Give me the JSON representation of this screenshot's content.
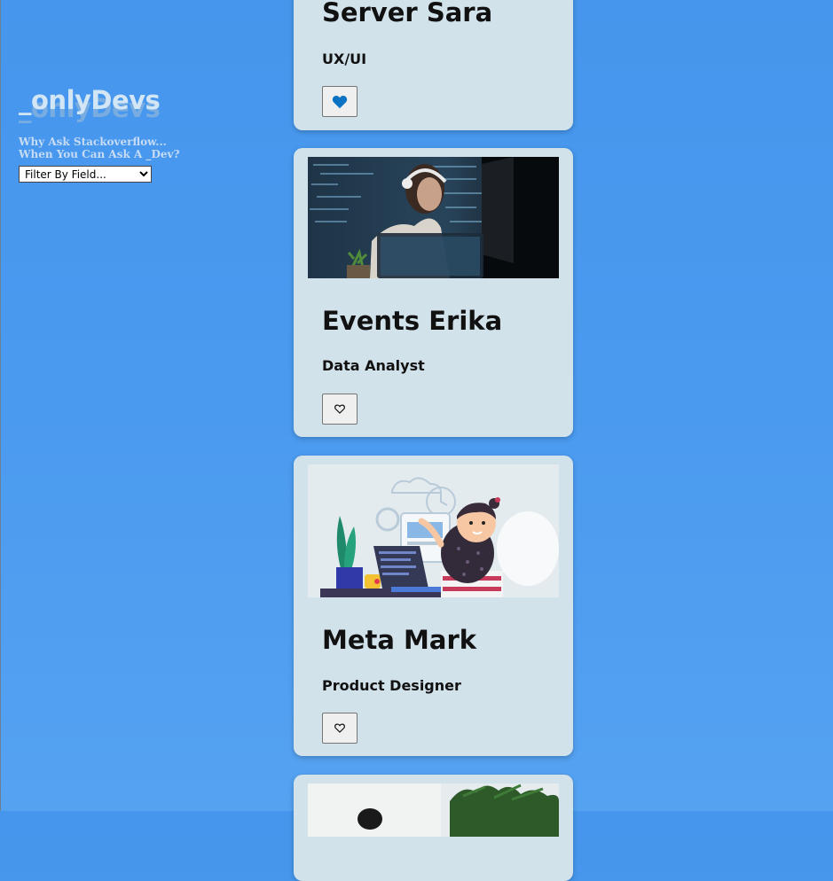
{
  "brand": {
    "logo": "_onlyDevs",
    "tagline_line1": "Why Ask Stackoverflow...",
    "tagline_line2": "When You Can Ask A _Dev?"
  },
  "filter": {
    "selected": "Filter By Field..."
  },
  "cards": [
    {
      "name": "Server Sara",
      "role": "UX/UI",
      "liked": true,
      "image": "none-visible"
    },
    {
      "name": "Events Erika",
      "role": "Data Analyst",
      "liked": false,
      "image": "woman-with-headset-at-computer-photo"
    },
    {
      "name": "Meta Mark",
      "role": "Product Designer",
      "liked": false,
      "image": "bearded-developer-illustration"
    },
    {
      "name": "",
      "role": "",
      "liked": false,
      "image": "office-plant-photo"
    }
  ],
  "colors": {
    "background": "#4a9af0",
    "card": "#d2e2eb",
    "heart_filled": "#0b72c4"
  }
}
